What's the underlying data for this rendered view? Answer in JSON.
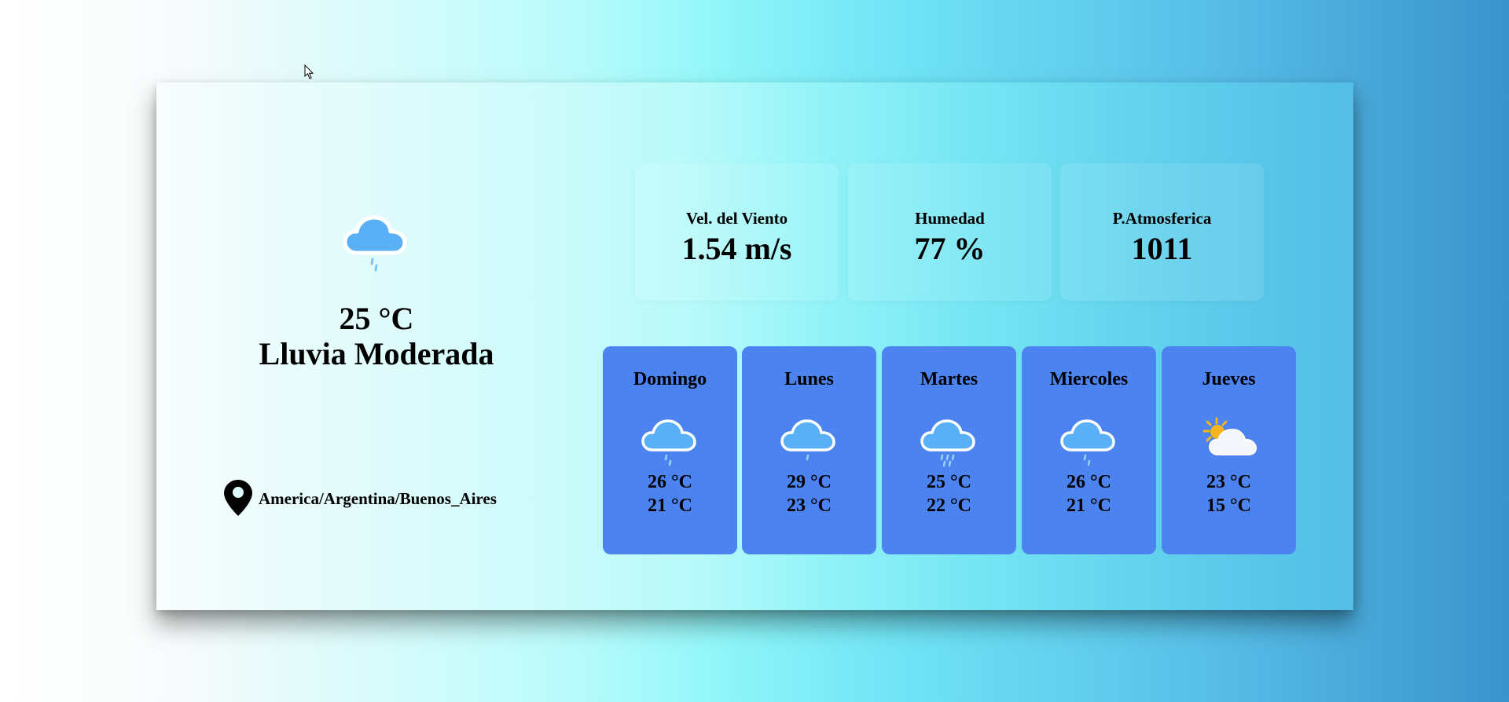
{
  "current": {
    "icon": "cloud-rain-light-icon",
    "temperature": "25 °C",
    "description": "Lluvia Moderada",
    "location_icon": "map-pin-icon",
    "timezone": "America/Argentina/Buenos_Aires"
  },
  "stats": [
    {
      "label": "Vel. del Viento",
      "value": "1.54 m/s"
    },
    {
      "label": "Humedad",
      "value": "77 %"
    },
    {
      "label": "P.Atmosferica",
      "value": "1011"
    }
  ],
  "forecast": [
    {
      "day": "Domingo",
      "icon": "cloud-rain-light-icon",
      "max": "26 °C",
      "min": "21 °C"
    },
    {
      "day": "Lunes",
      "icon": "cloud-drizzle-icon",
      "max": "29 °C",
      "min": "23 °C"
    },
    {
      "day": "Martes",
      "icon": "cloud-rain-icon",
      "max": "25 °C",
      "min": "22 °C"
    },
    {
      "day": "Miercoles",
      "icon": "cloud-rain-light-icon",
      "max": "26 °C",
      "min": "21 °C"
    },
    {
      "day": "Jueves",
      "icon": "partly-cloudy-icon",
      "max": "23 °C",
      "min": "15 °C"
    }
  ],
  "colors": {
    "forecast_card": "#4a82f0",
    "cloud_fill": "#5ab0f6",
    "cloud_outline": "#ffffff",
    "sun": "#f6b51e"
  }
}
